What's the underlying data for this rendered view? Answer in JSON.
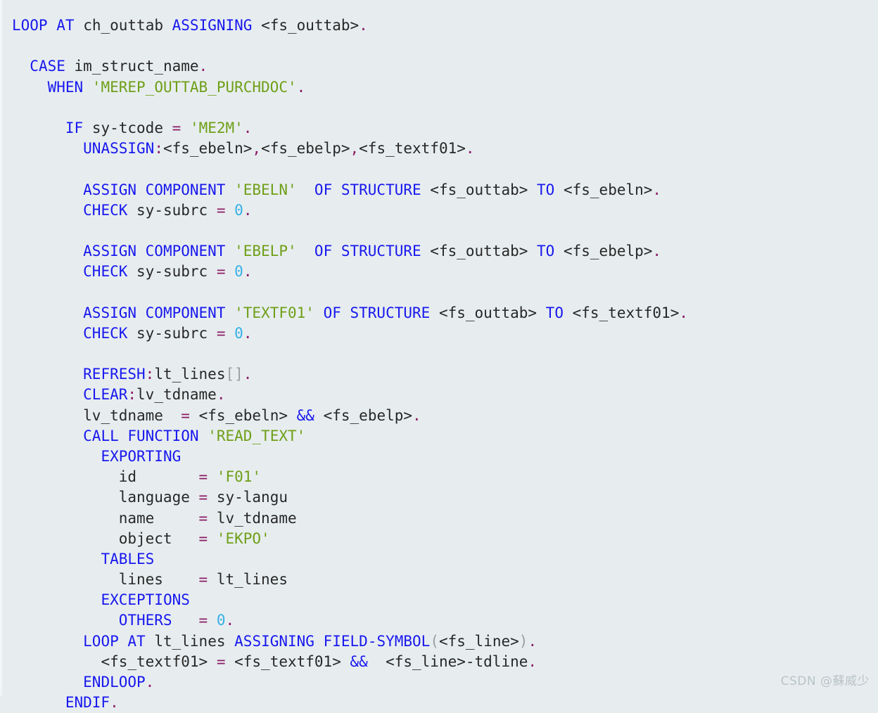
{
  "editor": {
    "language": "ABAP",
    "background_color": "#e7edef",
    "font_size_px": 21,
    "line_height_px": 29.2,
    "colors": {
      "keyword": "#1818ee",
      "identifier": "#272727",
      "string": "#6f9f18",
      "number": "#38b0e8",
      "punctuation": "#8c1a66",
      "operator": "#8c1a66",
      "bracket": "#9aa0a2",
      "field_symbol": "#272727"
    }
  },
  "watermark": {
    "text": "CSDN @蘇威少"
  },
  "code": {
    "plain_text": "LOOP AT ch_outtab ASSIGNING <fs_outtab>.\n\n  CASE im_struct_name.\n    WHEN 'MEREP_OUTTAB_PURCHDOC'.\n\n      IF sy-tcode = 'ME2M'.\n        UNASSIGN:<fs_ebeln>,<fs_ebelp>,<fs_textf01>.\n\n        ASSIGN COMPONENT 'EBELN' OF STRUCTURE <fs_outtab> TO <fs_ebeln>.\n        CHECK sy-subrc = 0.\n\n        ASSIGN COMPONENT 'EBELP' OF STRUCTURE <fs_outtab> TO <fs_ebelp>.\n        CHECK sy-subrc = 0.\n\n        ASSIGN COMPONENT 'TEXTF01' OF STRUCTURE <fs_outtab> TO <fs_textf01>.\n        CHECK sy-subrc = 0.\n\n        REFRESH:lt_lines[].\n        CLEAR:lv_tdname.\n        lv_tdname  = <fs_ebeln> && <fs_ebelp>.\n        CALL FUNCTION 'READ_TEXT'\n          EXPORTING\n            id       = 'F01'\n            language = sy-langu\n            name     = lv_tdname\n            object   = 'EKPO'\n          TABLES\n            lines    = lt_lines\n          EXCEPTIONS\n            OTHERS   = 0.\n        LOOP AT lt_lines ASSIGNING FIELD-SYMBOL(<fs_line>).\n          <fs_textf01> = <fs_textf01> &&  <fs_line>-tdline.\n        ENDLOOP.\n      ENDIF.",
    "lines": [
      {
        "indent": 0,
        "tokens": [
          {
            "t": "kw",
            "v": "LOOP"
          },
          {
            "t": "plain",
            "v": " "
          },
          {
            "t": "kw",
            "v": "AT"
          },
          {
            "t": "plain",
            "v": " "
          },
          {
            "t": "id",
            "v": "ch_outtab"
          },
          {
            "t": "plain",
            "v": " "
          },
          {
            "t": "kw",
            "v": "ASSIGNING"
          },
          {
            "t": "plain",
            "v": " "
          },
          {
            "t": "fs",
            "v": "<fs_outtab>"
          },
          {
            "t": "punc",
            "v": "."
          }
        ]
      },
      {
        "indent": 0,
        "tokens": []
      },
      {
        "indent": 2,
        "tokens": [
          {
            "t": "kw",
            "v": "CASE"
          },
          {
            "t": "plain",
            "v": " "
          },
          {
            "t": "id",
            "v": "im_struct_name"
          },
          {
            "t": "punc",
            "v": "."
          }
        ]
      },
      {
        "indent": 4,
        "tokens": [
          {
            "t": "kw",
            "v": "WHEN"
          },
          {
            "t": "plain",
            "v": " "
          },
          {
            "t": "str",
            "v": "'MEREP_OUTTAB_PURCHDOC'"
          },
          {
            "t": "punc",
            "v": "."
          }
        ]
      },
      {
        "indent": 0,
        "tokens": []
      },
      {
        "indent": 6,
        "tokens": [
          {
            "t": "kw",
            "v": "IF"
          },
          {
            "t": "plain",
            "v": " "
          },
          {
            "t": "id",
            "v": "sy-tcode"
          },
          {
            "t": "plain",
            "v": " "
          },
          {
            "t": "op",
            "v": "="
          },
          {
            "t": "plain",
            "v": " "
          },
          {
            "t": "str",
            "v": "'ME2M'"
          },
          {
            "t": "punc",
            "v": "."
          }
        ]
      },
      {
        "indent": 8,
        "tokens": [
          {
            "t": "kw",
            "v": "UNASSIGN"
          },
          {
            "t": "punc",
            "v": ":"
          },
          {
            "t": "fs",
            "v": "<fs_ebeln>"
          },
          {
            "t": "punc",
            "v": ","
          },
          {
            "t": "fs",
            "v": "<fs_ebelp>"
          },
          {
            "t": "punc",
            "v": ","
          },
          {
            "t": "fs",
            "v": "<fs_textf01>"
          },
          {
            "t": "punc",
            "v": "."
          }
        ]
      },
      {
        "indent": 0,
        "tokens": []
      },
      {
        "indent": 8,
        "tokens": [
          {
            "t": "kw",
            "v": "ASSIGN COMPONENT"
          },
          {
            "t": "plain",
            "v": " "
          },
          {
            "t": "str",
            "v": "'EBELN'"
          },
          {
            "t": "plain",
            "v": "  "
          },
          {
            "t": "kw",
            "v": "OF STRUCTURE"
          },
          {
            "t": "plain",
            "v": " "
          },
          {
            "t": "fs",
            "v": "<fs_outtab>"
          },
          {
            "t": "plain",
            "v": " "
          },
          {
            "t": "kw",
            "v": "TO"
          },
          {
            "t": "plain",
            "v": " "
          },
          {
            "t": "fs",
            "v": "<fs_ebeln>"
          },
          {
            "t": "punc",
            "v": "."
          }
        ]
      },
      {
        "indent": 8,
        "tokens": [
          {
            "t": "kw",
            "v": "CHECK"
          },
          {
            "t": "plain",
            "v": " "
          },
          {
            "t": "id",
            "v": "sy-subrc"
          },
          {
            "t": "plain",
            "v": " "
          },
          {
            "t": "op",
            "v": "="
          },
          {
            "t": "plain",
            "v": " "
          },
          {
            "t": "num",
            "v": "0"
          },
          {
            "t": "punc",
            "v": "."
          }
        ]
      },
      {
        "indent": 0,
        "tokens": []
      },
      {
        "indent": 8,
        "tokens": [
          {
            "t": "kw",
            "v": "ASSIGN COMPONENT"
          },
          {
            "t": "plain",
            "v": " "
          },
          {
            "t": "str",
            "v": "'EBELP'"
          },
          {
            "t": "plain",
            "v": "  "
          },
          {
            "t": "kw",
            "v": "OF STRUCTURE"
          },
          {
            "t": "plain",
            "v": " "
          },
          {
            "t": "fs",
            "v": "<fs_outtab>"
          },
          {
            "t": "plain",
            "v": " "
          },
          {
            "t": "kw",
            "v": "TO"
          },
          {
            "t": "plain",
            "v": " "
          },
          {
            "t": "fs",
            "v": "<fs_ebelp>"
          },
          {
            "t": "punc",
            "v": "."
          }
        ]
      },
      {
        "indent": 8,
        "tokens": [
          {
            "t": "kw",
            "v": "CHECK"
          },
          {
            "t": "plain",
            "v": " "
          },
          {
            "t": "id",
            "v": "sy-subrc"
          },
          {
            "t": "plain",
            "v": " "
          },
          {
            "t": "op",
            "v": "="
          },
          {
            "t": "plain",
            "v": " "
          },
          {
            "t": "num",
            "v": "0"
          },
          {
            "t": "punc",
            "v": "."
          }
        ]
      },
      {
        "indent": 0,
        "tokens": []
      },
      {
        "indent": 8,
        "tokens": [
          {
            "t": "kw",
            "v": "ASSIGN COMPONENT"
          },
          {
            "t": "plain",
            "v": " "
          },
          {
            "t": "str",
            "v": "'TEXTF01'"
          },
          {
            "t": "plain",
            "v": " "
          },
          {
            "t": "kw",
            "v": "OF STRUCTURE"
          },
          {
            "t": "plain",
            "v": " "
          },
          {
            "t": "fs",
            "v": "<fs_outtab>"
          },
          {
            "t": "plain",
            "v": " "
          },
          {
            "t": "kw",
            "v": "TO"
          },
          {
            "t": "plain",
            "v": " "
          },
          {
            "t": "fs",
            "v": "<fs_textf01>"
          },
          {
            "t": "punc",
            "v": "."
          }
        ]
      },
      {
        "indent": 8,
        "tokens": [
          {
            "t": "kw",
            "v": "CHECK"
          },
          {
            "t": "plain",
            "v": " "
          },
          {
            "t": "id",
            "v": "sy-subrc"
          },
          {
            "t": "plain",
            "v": " "
          },
          {
            "t": "op",
            "v": "="
          },
          {
            "t": "plain",
            "v": " "
          },
          {
            "t": "num",
            "v": "0"
          },
          {
            "t": "punc",
            "v": "."
          }
        ]
      },
      {
        "indent": 0,
        "tokens": []
      },
      {
        "indent": 8,
        "tokens": [
          {
            "t": "kw",
            "v": "REFRESH"
          },
          {
            "t": "punc",
            "v": ":"
          },
          {
            "t": "id",
            "v": "lt_lines"
          },
          {
            "t": "brk",
            "v": "[]"
          },
          {
            "t": "punc",
            "v": "."
          }
        ]
      },
      {
        "indent": 8,
        "tokens": [
          {
            "t": "kw",
            "v": "CLEAR"
          },
          {
            "t": "punc",
            "v": ":"
          },
          {
            "t": "id",
            "v": "lv_tdname"
          },
          {
            "t": "punc",
            "v": "."
          }
        ]
      },
      {
        "indent": 8,
        "tokens": [
          {
            "t": "id",
            "v": "lv_tdname"
          },
          {
            "t": "plain",
            "v": "  "
          },
          {
            "t": "op",
            "v": "="
          },
          {
            "t": "plain",
            "v": " "
          },
          {
            "t": "fs",
            "v": "<fs_ebeln>"
          },
          {
            "t": "plain",
            "v": " "
          },
          {
            "t": "kw",
            "v": "&&"
          },
          {
            "t": "plain",
            "v": " "
          },
          {
            "t": "fs",
            "v": "<fs_ebelp>"
          },
          {
            "t": "punc",
            "v": "."
          }
        ]
      },
      {
        "indent": 8,
        "tokens": [
          {
            "t": "kw",
            "v": "CALL FUNCTION"
          },
          {
            "t": "plain",
            "v": " "
          },
          {
            "t": "str",
            "v": "'READ_TEXT'"
          }
        ]
      },
      {
        "indent": 10,
        "tokens": [
          {
            "t": "kw",
            "v": "EXPORTING"
          }
        ]
      },
      {
        "indent": 12,
        "tokens": [
          {
            "t": "id",
            "v": "id"
          },
          {
            "t": "plain",
            "v": "       "
          },
          {
            "t": "op",
            "v": "="
          },
          {
            "t": "plain",
            "v": " "
          },
          {
            "t": "str",
            "v": "'F01'"
          }
        ]
      },
      {
        "indent": 12,
        "tokens": [
          {
            "t": "id",
            "v": "language"
          },
          {
            "t": "plain",
            "v": " "
          },
          {
            "t": "op",
            "v": "="
          },
          {
            "t": "plain",
            "v": " "
          },
          {
            "t": "id",
            "v": "sy-langu"
          }
        ]
      },
      {
        "indent": 12,
        "tokens": [
          {
            "t": "id",
            "v": "name"
          },
          {
            "t": "plain",
            "v": "     "
          },
          {
            "t": "op",
            "v": "="
          },
          {
            "t": "plain",
            "v": " "
          },
          {
            "t": "id",
            "v": "lv_tdname"
          }
        ]
      },
      {
        "indent": 12,
        "tokens": [
          {
            "t": "id",
            "v": "object"
          },
          {
            "t": "plain",
            "v": "   "
          },
          {
            "t": "op",
            "v": "="
          },
          {
            "t": "plain",
            "v": " "
          },
          {
            "t": "str",
            "v": "'EKPO'"
          }
        ]
      },
      {
        "indent": 10,
        "tokens": [
          {
            "t": "kw",
            "v": "TABLES"
          }
        ]
      },
      {
        "indent": 12,
        "tokens": [
          {
            "t": "id",
            "v": "lines"
          },
          {
            "t": "plain",
            "v": "    "
          },
          {
            "t": "op",
            "v": "="
          },
          {
            "t": "plain",
            "v": " "
          },
          {
            "t": "id",
            "v": "lt_lines"
          }
        ]
      },
      {
        "indent": 10,
        "tokens": [
          {
            "t": "kw",
            "v": "EXCEPTIONS"
          }
        ]
      },
      {
        "indent": 12,
        "tokens": [
          {
            "t": "kw",
            "v": "OTHERS"
          },
          {
            "t": "plain",
            "v": "   "
          },
          {
            "t": "op",
            "v": "="
          },
          {
            "t": "plain",
            "v": " "
          },
          {
            "t": "num",
            "v": "0"
          },
          {
            "t": "punc",
            "v": "."
          }
        ]
      },
      {
        "indent": 8,
        "tokens": [
          {
            "t": "kw",
            "v": "LOOP"
          },
          {
            "t": "plain",
            "v": " "
          },
          {
            "t": "kw",
            "v": "AT"
          },
          {
            "t": "plain",
            "v": " "
          },
          {
            "t": "id",
            "v": "lt_lines"
          },
          {
            "t": "plain",
            "v": " "
          },
          {
            "t": "kw",
            "v": "ASSIGNING"
          },
          {
            "t": "plain",
            "v": " "
          },
          {
            "t": "kw",
            "v": "FIELD-SYMBOL"
          },
          {
            "t": "brk",
            "v": "("
          },
          {
            "t": "fs",
            "v": "<fs_line>"
          },
          {
            "t": "brk",
            "v": ")"
          },
          {
            "t": "punc",
            "v": "."
          }
        ]
      },
      {
        "indent": 10,
        "tokens": [
          {
            "t": "fs",
            "v": "<fs_textf01>"
          },
          {
            "t": "plain",
            "v": " "
          },
          {
            "t": "op",
            "v": "="
          },
          {
            "t": "plain",
            "v": " "
          },
          {
            "t": "fs",
            "v": "<fs_textf01>"
          },
          {
            "t": "plain",
            "v": " "
          },
          {
            "t": "kw",
            "v": "&&"
          },
          {
            "t": "plain",
            "v": "  "
          },
          {
            "t": "fs",
            "v": "<fs_line>-tdline"
          },
          {
            "t": "punc",
            "v": "."
          }
        ]
      },
      {
        "indent": 8,
        "tokens": [
          {
            "t": "kw",
            "v": "ENDLOOP"
          },
          {
            "t": "punc",
            "v": "."
          }
        ]
      },
      {
        "indent": 6,
        "tokens": [
          {
            "t": "kw",
            "v": "ENDIF"
          },
          {
            "t": "punc",
            "v": "."
          }
        ]
      }
    ]
  }
}
